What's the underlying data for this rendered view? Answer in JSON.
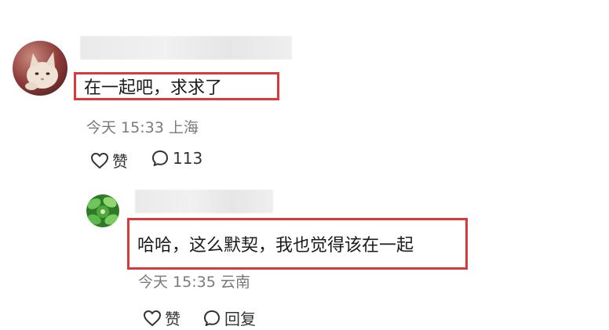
{
  "comments": [
    {
      "avatar_icon": "cat-avatar-icon",
      "text": "在一起吧，求求了",
      "time": "今天 15:33",
      "location": "上海",
      "like_label": "赞",
      "reply_count": "113",
      "like_icon": "heart-outline-icon",
      "reply_icon": "speech-bubble-icon"
    },
    {
      "avatar_icon": "green-leaf-avatar-icon",
      "text": "哈哈，这么默契，我也觉得该在一起",
      "time": "今天 15:35",
      "location": "云南",
      "like_label": "赞",
      "reply_label": "回复",
      "like_icon": "heart-outline-icon",
      "reply_icon": "speech-bubble-icon"
    }
  ],
  "colors": {
    "highlight_border": "#d63a3a",
    "meta_text": "#7a7a7a",
    "body_text": "#1a1a1a"
  }
}
